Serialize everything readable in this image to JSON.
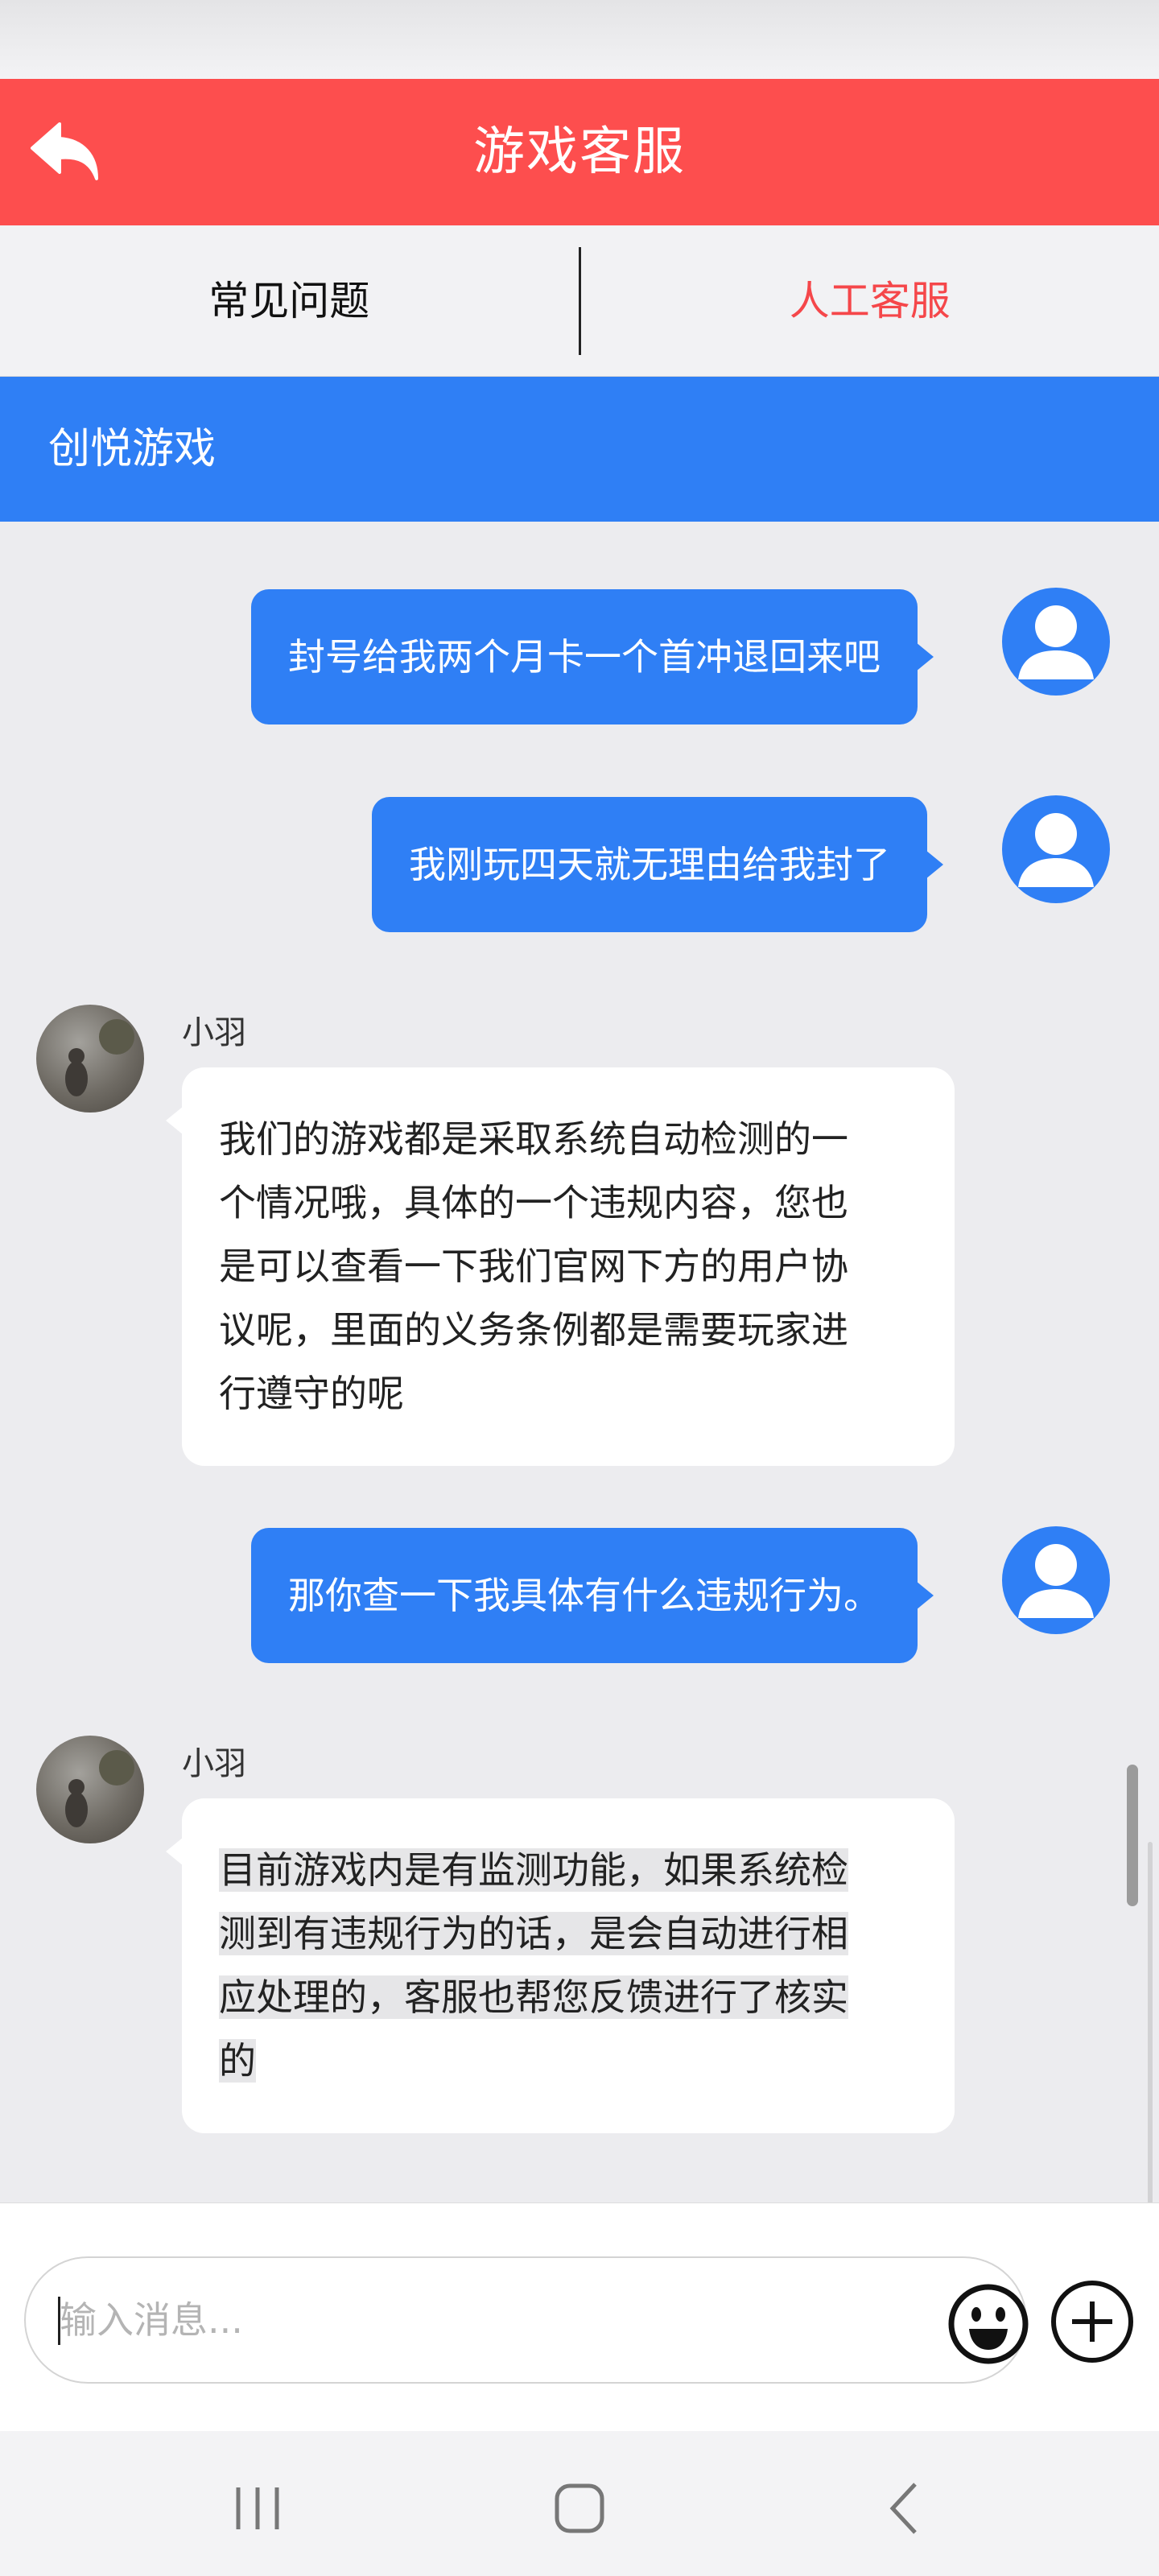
{
  "header": {
    "title": "游戏客服",
    "back_icon": "back-arrow-icon",
    "color": "#fd4e4e"
  },
  "tabs": [
    {
      "label": "常见问题",
      "active": false
    },
    {
      "label": "人工客服",
      "active": true
    }
  ],
  "company": {
    "name": "创悦游戏",
    "color": "#2f7ff5"
  },
  "messages": [
    {
      "from": "user",
      "text": "封号给我两个月卡一个首冲退回来吧"
    },
    {
      "from": "user",
      "text": "我刚玩四天就无理由给我封了"
    },
    {
      "from": "agent",
      "name": "小羽",
      "lines": [
        "我们的游戏都是采取系统自动检测的一",
        "个情况哦，具体的一个违规内容，您也",
        "是可以查看一下我们官网下方的用户协",
        "议呢，里面的义务条例都是需要玩家进",
        "行遵守的呢"
      ]
    },
    {
      "from": "user",
      "text": "那你查一下我具体有什么违规行为。"
    },
    {
      "from": "agent",
      "name": "小羽",
      "lines": [
        "目前游戏内是有监测功能，如果系统检",
        "测到有违规行为的话，是会自动进行相",
        "应处理的，客服也帮您反馈进行了核实",
        "的"
      ]
    }
  ],
  "input": {
    "placeholder": "输入消息...",
    "value": ""
  },
  "icons": {
    "emoji": "emoji-icon",
    "add": "plus-icon",
    "nav_recent": "recent-apps-icon",
    "nav_home": "home-icon",
    "nav_back": "back-icon"
  }
}
